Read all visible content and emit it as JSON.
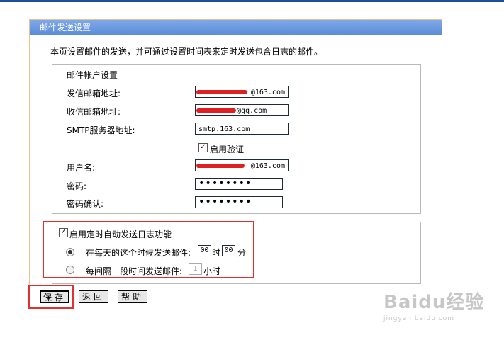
{
  "panel": {
    "title": "邮件发送设置",
    "description": "本页设置邮件的发送，并可通过设置时间表来定时发送包含日志的邮件。"
  },
  "account": {
    "section_title": "邮件帐户设置",
    "sender_label": "发信邮箱地址:",
    "sender_value": "@163.com",
    "receiver_label": "收信邮箱地址:",
    "receiver_value": "@qq.com",
    "smtp_label": "SMTP服务器地址:",
    "smtp_value": "smtp.163.com",
    "auth_label": "启用验证",
    "auth_checked": true,
    "username_label": "用户名:",
    "username_value": "@163.com",
    "password_label": "密码:",
    "password_value": "••••••••",
    "confirm_label": "密码确认:",
    "confirm_value": "••••••••"
  },
  "schedule": {
    "enable_label": "启用定时自动发送日志功能",
    "enable_checked": true,
    "daily_label": "在每天的这个时候发送邮件:",
    "hour_value": "00",
    "hour_unit": "时",
    "minute_value": "00",
    "minute_unit": "分",
    "interval_label": "每间隔一段时间发送邮件:",
    "interval_value": "1",
    "interval_unit": "小时"
  },
  "buttons": {
    "save": "保存",
    "back": "返回",
    "help": "帮助"
  },
  "watermark": {
    "logo": "Baidu经验",
    "url": "jingyan.baidu.com"
  },
  "colors": {
    "header": "#5b8bd8",
    "panel_border": "#e3c38d",
    "highlight": "#e03030"
  }
}
